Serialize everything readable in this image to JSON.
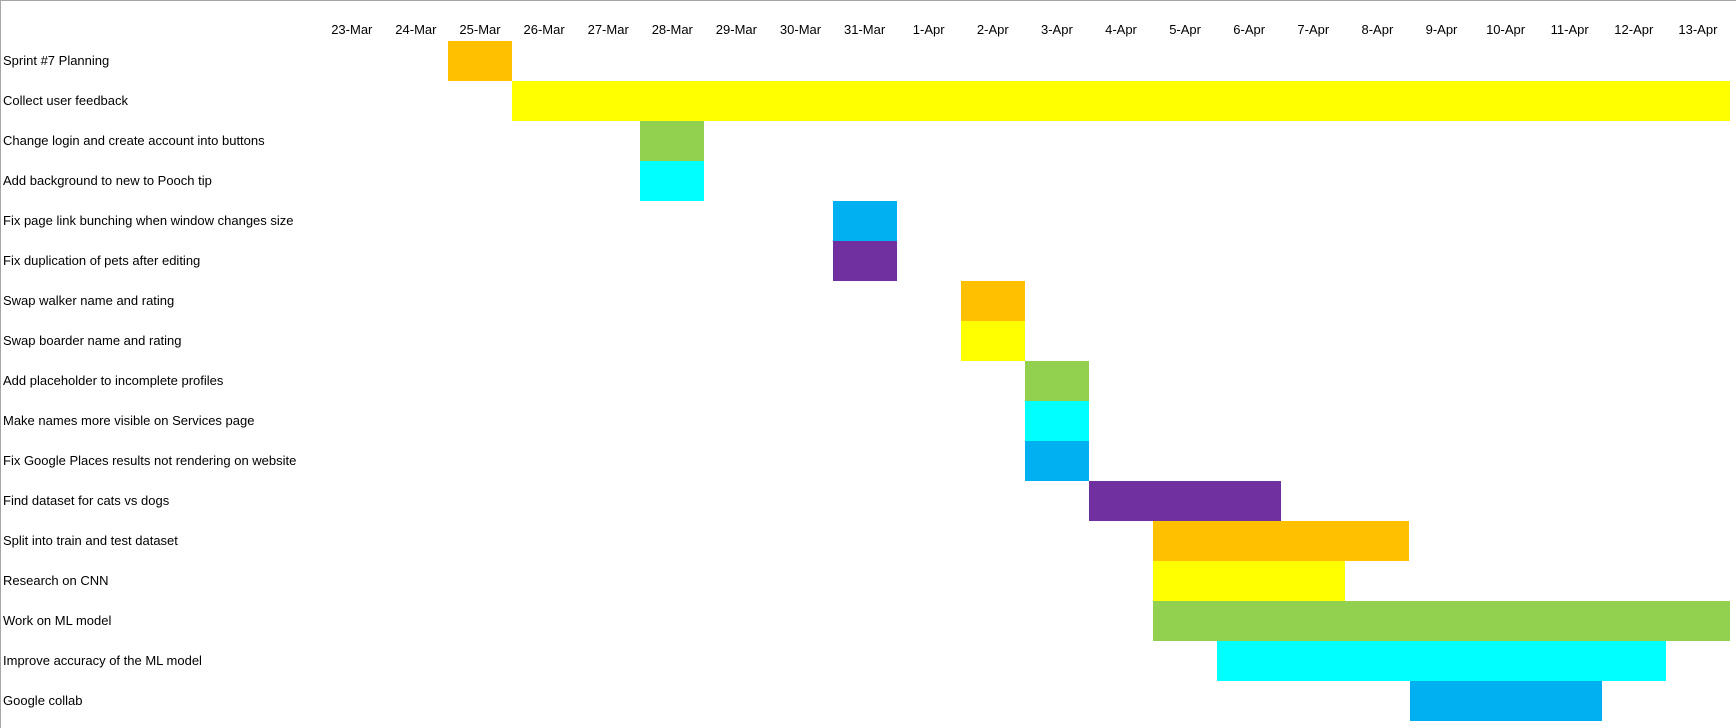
{
  "chart_data": {
    "type": "gantt",
    "title": "",
    "dates": [
      "23-Mar",
      "24-Mar",
      "25-Mar",
      "26-Mar",
      "27-Mar",
      "28-Mar",
      "29-Mar",
      "30-Mar",
      "31-Mar",
      "1-Apr",
      "2-Apr",
      "3-Apr",
      "4-Apr",
      "5-Apr",
      "6-Apr",
      "7-Apr",
      "8-Apr",
      "9-Apr",
      "10-Apr",
      "11-Apr",
      "12-Apr",
      "13-Apr"
    ],
    "tasks": [
      {
        "name": "Sprint #7 Planning",
        "start": "25-Mar",
        "end": "25-Mar",
        "color": "#FFC000"
      },
      {
        "name": "Collect user feedback",
        "start": "26-Mar",
        "end": "13-Apr",
        "color": "#FFFF00"
      },
      {
        "name": "Change login and create account into buttons",
        "start": "28-Mar",
        "end": "28-Mar",
        "color": "#92D050"
      },
      {
        "name": "Add background to new to Pooch tip",
        "start": "28-Mar",
        "end": "28-Mar",
        "color": "#00FFFF"
      },
      {
        "name": "Fix page link bunching when window changes size",
        "start": "31-Mar",
        "end": "31-Mar",
        "color": "#00B0F0"
      },
      {
        "name": "Fix duplication of pets after editing",
        "start": "31-Mar",
        "end": "31-Mar",
        "color": "#7030A0"
      },
      {
        "name": "Swap walker name and rating",
        "start": "2-Apr",
        "end": "2-Apr",
        "color": "#FFC000"
      },
      {
        "name": "Swap boarder name and rating",
        "start": "2-Apr",
        "end": "2-Apr",
        "color": "#FFFF00"
      },
      {
        "name": "Add placeholder to incomplete profiles",
        "start": "3-Apr",
        "end": "3-Apr",
        "color": "#92D050"
      },
      {
        "name": "Make names more visible on Services page",
        "start": "3-Apr",
        "end": "3-Apr",
        "color": "#00FFFF"
      },
      {
        "name": "Fix Google Places results not rendering on website",
        "start": "3-Apr",
        "end": "3-Apr",
        "color": "#00B0F0"
      },
      {
        "name": "Find dataset for cats vs dogs",
        "start": "4-Apr",
        "end": "6-Apr",
        "color": "#7030A0"
      },
      {
        "name": "Split into train and test dataset",
        "start": "5-Apr",
        "end": "8-Apr",
        "color": "#FFC000"
      },
      {
        "name": "Research on CNN",
        "start": "5-Apr",
        "end": "7-Apr",
        "color": "#FFFF00"
      },
      {
        "name": "Work on ML model",
        "start": "5-Apr",
        "end": "13-Apr",
        "color": "#92D050"
      },
      {
        "name": "Improve accuracy of the ML model",
        "start": "6-Apr",
        "end": "12-Apr",
        "color": "#00FFFF"
      },
      {
        "name": "Google collab",
        "start": "9-Apr",
        "end": "11-Apr",
        "color": "#00B0F0"
      }
    ]
  }
}
